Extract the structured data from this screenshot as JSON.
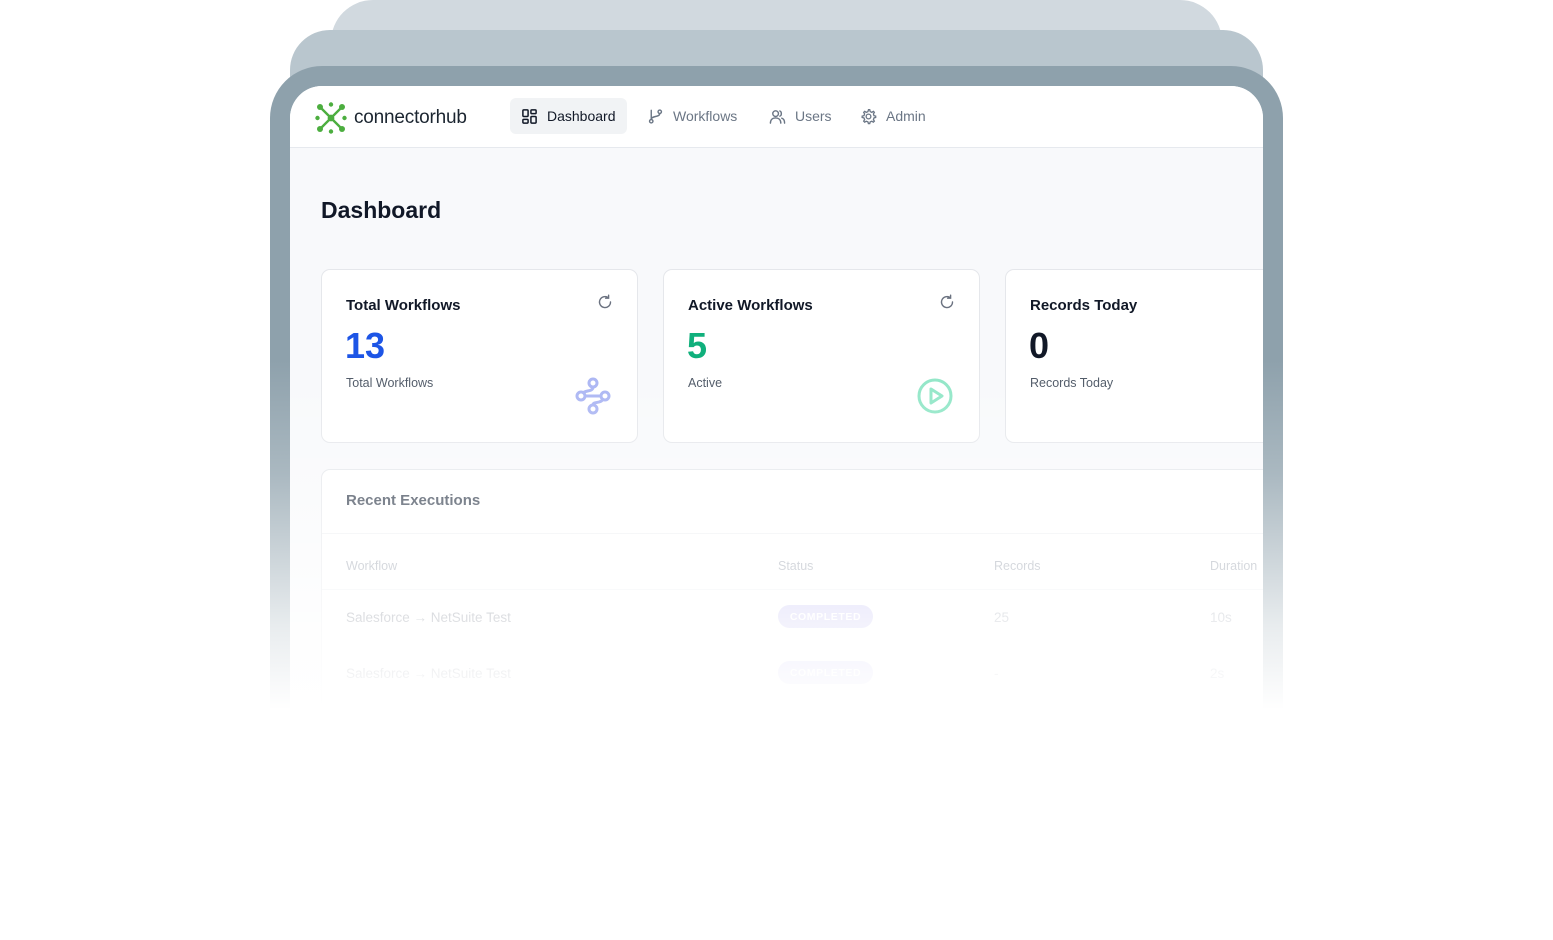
{
  "app": {
    "name": "connectorhub",
    "logo_icon": "connectorhub-logo-icon",
    "brand_color": "#4cae3f"
  },
  "nav": [
    {
      "label": "Dashboard",
      "icon": "dashboard-grid-icon",
      "active": true
    },
    {
      "label": "Workflows",
      "icon": "git-branch-icon",
      "active": false
    },
    {
      "label": "Users",
      "icon": "users-icon",
      "active": false
    },
    {
      "label": "Admin",
      "icon": "gear-icon",
      "active": false
    }
  ],
  "page": {
    "title": "Dashboard"
  },
  "cards": [
    {
      "title": "Total Workflows",
      "value": "13",
      "subtitle": "Total Workflows",
      "value_color": "#1d55e6",
      "icon": "workflow-nodes-icon",
      "refresh_icon": "refresh-icon"
    },
    {
      "title": "Active Workflows",
      "value": "5",
      "subtitle": "Active",
      "value_color": "#10b07c",
      "icon": "play-circle-icon",
      "refresh_icon": "refresh-icon"
    },
    {
      "title": "Records Today",
      "value": "0",
      "subtitle": "Records Today",
      "value_color": "#111827"
    }
  ],
  "executions": {
    "title": "Recent Executions",
    "columns": [
      "Workflow",
      "Status",
      "Records",
      "Duration"
    ],
    "rows": [
      {
        "workflow": "Salesforce → NetSuite Test",
        "status": "COMPLETED",
        "records": "25",
        "duration": "10s"
      },
      {
        "workflow": "Salesforce → NetSuite Test",
        "status": "COMPLETED",
        "records": "-",
        "duration": "2s"
      }
    ]
  }
}
